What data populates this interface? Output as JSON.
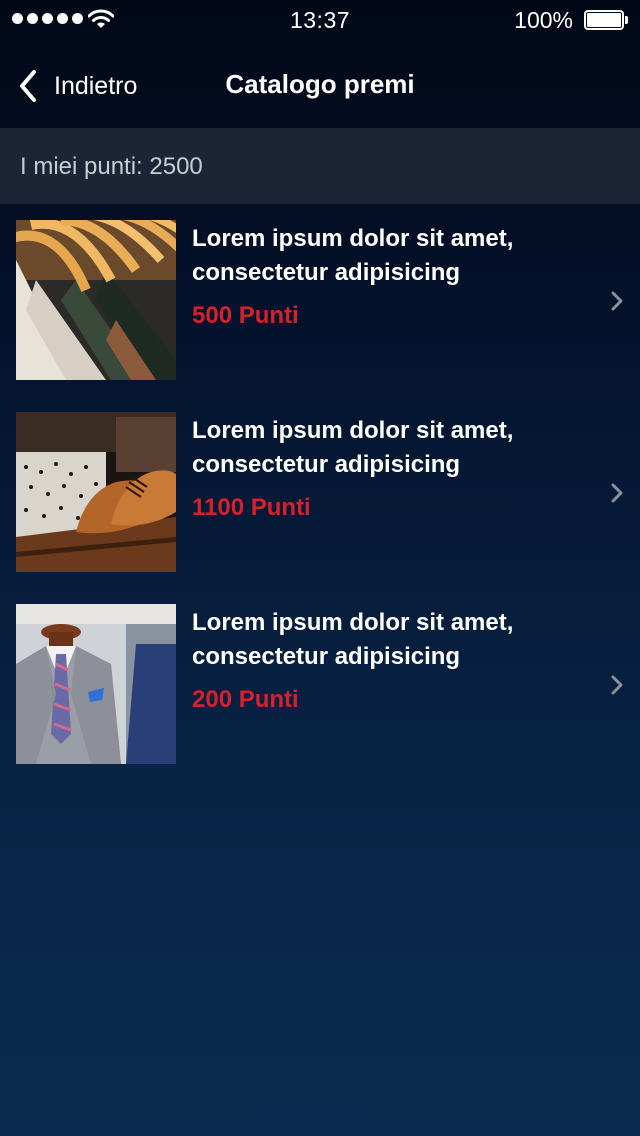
{
  "status_bar": {
    "time": "13:37",
    "battery": "100%",
    "signal_icon": "signal-dots-icon",
    "wifi_icon": "wifi-icon",
    "battery_icon": "battery-icon"
  },
  "nav": {
    "back_label": "Indietro",
    "back_icon": "chevron-left-icon",
    "title": "Catalogo premi"
  },
  "points": {
    "label": "I miei punti: 2500"
  },
  "items": [
    {
      "title_line1": "Lorem ipsum dolor sit amet,",
      "title_line2": "consectetur adipisicing",
      "points": "500 Punti",
      "image": "shirts-on-hangers-photo"
    },
    {
      "title_line1": "Lorem ipsum dolor sit amet,",
      "title_line2": "consectetur adipisicing",
      "points": "1100 Punti",
      "image": "leather-shoes-photo"
    },
    {
      "title_line1": "Lorem ipsum dolor sit amet,",
      "title_line2": "consectetur adipisicing",
      "points": "200 Punti",
      "image": "suit-on-mannequin-photo"
    }
  ],
  "colors": {
    "points_accent": "#d7202c",
    "header_band": "#1c2535",
    "background_top": "#020816",
    "background_bottom": "#0b2c50"
  }
}
